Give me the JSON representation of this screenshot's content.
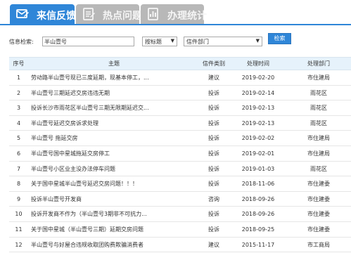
{
  "tabs": [
    {
      "label": "来信反馈",
      "icon": "mail-feedback-icon",
      "active": true
    },
    {
      "label": "热点问题",
      "icon": "hot-topics-icon",
      "active": false
    },
    {
      "label": "办理统计",
      "icon": "statistics-icon",
      "active": false
    }
  ],
  "search": {
    "label": "信息检索:",
    "value": "半山壹号",
    "type_select": "按标题",
    "dept_select": "信件部门",
    "button": "检索"
  },
  "table": {
    "headers": [
      "序号",
      "主题",
      "信件类别",
      "处理时间",
      "处理部门"
    ],
    "rows": [
      [
        "1",
        "劳动路半山壹号现已三度延期，现基本停工，...",
        "建议",
        "2019-02-20",
        "市住建局"
      ],
      [
        "2",
        "半山壹号三期延迟交房违违无期",
        "投诉",
        "2019-02-14",
        "雨花区"
      ],
      [
        "3",
        "投诉长沙市雨花区半山壹号三期无限期延迟交...",
        "投诉",
        "2019-02-13",
        "雨花区"
      ],
      [
        "4",
        "半山壹号延迟交房诉求处理",
        "投诉",
        "2019-02-13",
        "雨花区"
      ],
      [
        "5",
        "半山壹号 拖延交房",
        "投诉",
        "2019-02-02",
        "市住建局"
      ],
      [
        "6",
        "半山壹号国中星城拖延交房停工",
        "投诉",
        "2019-02-01",
        "市住建局"
      ],
      [
        "7",
        "半山壹号小区业主没办法停车问题",
        "投诉",
        "2019-01-03",
        "雨花区"
      ],
      [
        "8",
        "关于国中星城半山壹号延迟交房问题！！！",
        "投诉",
        "2018-11-06",
        "市住建委"
      ],
      [
        "9",
        "投诉半山壹号开发商",
        "咨询",
        "2018-09-26",
        "市住建委"
      ],
      [
        "10",
        "投诉开发商不作为（半山壹号3期非不可抗力...",
        "投诉",
        "2018-09-26",
        "市住建委"
      ],
      [
        "11",
        "关于国中星城（半山壹号三期）延期交房问题",
        "投诉",
        "2018-09-25",
        "市住建委"
      ],
      [
        "12",
        "半山壹号与好屋合违规收取团购费欺骗消费者",
        "建议",
        "2015-11-17",
        "市工商局"
      ]
    ]
  },
  "colors": {
    "accent": "#2f86d8",
    "header_bg": "#e6f2fb",
    "tab_inactive": "#b8b8b8"
  }
}
